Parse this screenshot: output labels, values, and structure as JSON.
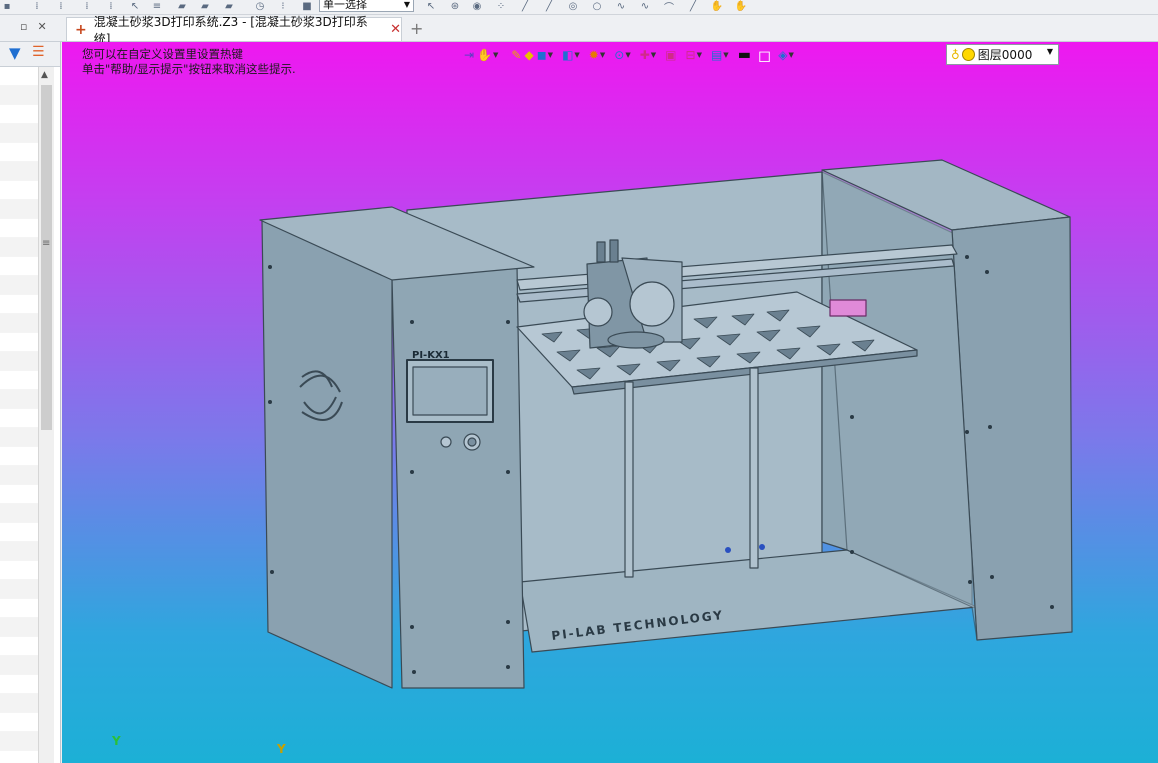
{
  "toolbar": {
    "select_mode": "单一选择"
  },
  "document_tab": {
    "title": "混凝土砂浆3D打印系统.Z3 - [混凝土砂浆3D打印系统]"
  },
  "viewport": {
    "hint_line1": "您可以在自定义设置里设置热键",
    "hint_line2": "单击\"帮助/显示提示\"按钮来取消这些提示.",
    "layer": "图层0000",
    "panel_label": "PI-KX1",
    "base_label": "PI-LAB TECHNOLOGY",
    "axis_y1": "Y",
    "axis_y2": "Y"
  },
  "colors": {
    "gradient_top": "#ee18f0",
    "gradient_bottom": "#1cb0d6",
    "model": "#98b0c0"
  }
}
